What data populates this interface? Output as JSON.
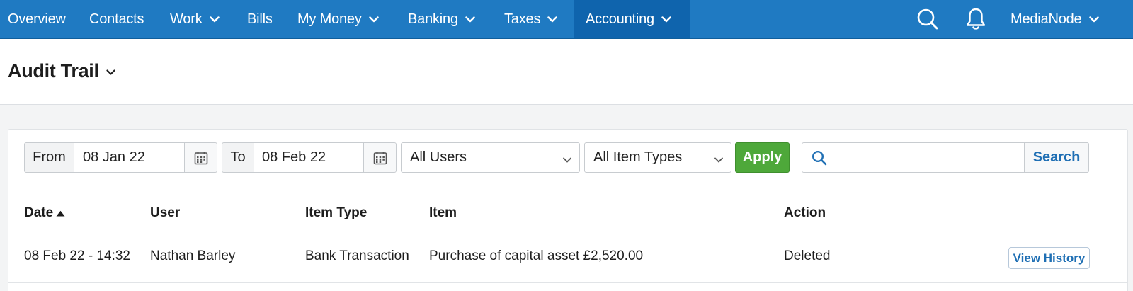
{
  "nav": {
    "items": [
      {
        "label": "Overview",
        "dropdown": false
      },
      {
        "label": "Contacts",
        "dropdown": false
      },
      {
        "label": "Work",
        "dropdown": true
      },
      {
        "label": "Bills",
        "dropdown": false
      },
      {
        "label": "My Money",
        "dropdown": true
      },
      {
        "label": "Banking",
        "dropdown": true
      },
      {
        "label": "Taxes",
        "dropdown": true
      },
      {
        "label": "Accounting",
        "dropdown": true,
        "active": true
      }
    ],
    "account_label": "MediaNode",
    "icons": [
      "search-icon",
      "bell-icon",
      "chevron-down-icon"
    ]
  },
  "header": {
    "title": "Audit Trail"
  },
  "filters": {
    "from_label": "From",
    "from_value": "08 Jan 22",
    "to_label": "To",
    "to_value": "08 Feb 22",
    "users_select": "All Users",
    "item_types_select": "All Item Types",
    "apply_label": "Apply",
    "search_value": "",
    "search_label": "Search"
  },
  "table": {
    "columns": [
      "Date",
      "User",
      "Item Type",
      "Item",
      "Action"
    ],
    "sort_column": "Date",
    "rows": [
      {
        "date": "08 Feb 22 - 14:32",
        "user": "Nathan Barley",
        "item_type": "Bank Transaction",
        "item": "Purchase of capital asset £2,520.00",
        "action": "Deleted",
        "button_label": "View History"
      }
    ]
  },
  "colors": {
    "nav_bg": "#1f7ac2",
    "nav_active_bg": "#0f64ad",
    "apply_green": "#4ea83a",
    "link_blue": "#1f6fb4"
  }
}
